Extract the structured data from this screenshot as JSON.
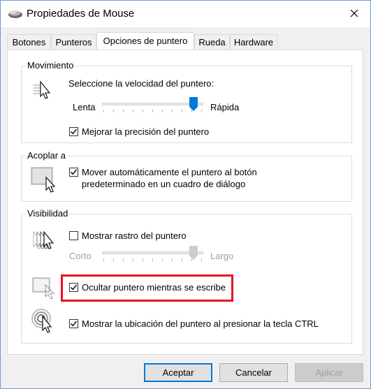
{
  "window": {
    "title": "Propiedades de Mouse"
  },
  "tabs": [
    {
      "label": "Botones"
    },
    {
      "label": "Punteros"
    },
    {
      "label": "Opciones de puntero"
    },
    {
      "label": "Rueda"
    },
    {
      "label": "Hardware"
    }
  ],
  "active_tab": "Opciones de puntero",
  "movement": {
    "title": "Movimiento",
    "speed_label": "Seleccione la velocidad del puntero:",
    "slow_label": "Lenta",
    "fast_label": "Rápida",
    "speed_level": 0.92,
    "precision_label": "Mejorar la precisión del puntero",
    "precision_checked": true
  },
  "snap": {
    "title": "Acoplar a",
    "line1": "Mover automáticamente el puntero al botón",
    "line2": "predeterminado en un cuadro de diálogo",
    "checked": true
  },
  "visibility": {
    "title": "Visibilidad",
    "trails_label": "Mostrar rastro del puntero",
    "trails_checked": false,
    "short_label": "Corto",
    "long_label": "Largo",
    "trail_level": 0.92,
    "hide_label": "Ocultar puntero mientras se escribe",
    "hide_checked": true,
    "show_ctrl_label": "Mostrar la ubicación del puntero al presionar la tecla CTRL",
    "show_ctrl_checked": true
  },
  "buttons": {
    "ok": "Aceptar",
    "cancel": "Cancelar",
    "apply": "Aplicar"
  },
  "colors": {
    "accent": "#0078d7",
    "highlight": "#e81123"
  }
}
